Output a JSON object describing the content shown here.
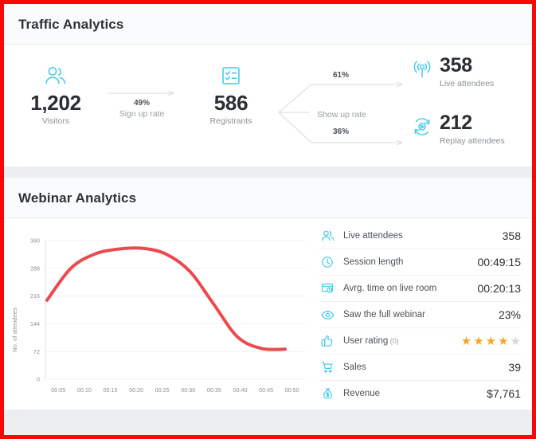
{
  "traffic": {
    "title": "Traffic Analytics",
    "visitors": {
      "icon": "users-icon",
      "value": "1,202",
      "label": "Visitors"
    },
    "registrants": {
      "icon": "checklist-icon",
      "value": "586",
      "label": "Registrants"
    },
    "signup_rate": {
      "pct": "49%",
      "caption": "Sign up rate"
    },
    "show_up_rate": {
      "caption": "Show up rate",
      "live_pct": "61%",
      "replay_pct": "36%"
    },
    "live_attendees": {
      "icon": "broadcast-icon",
      "value": "358",
      "label": "Live attendees"
    },
    "replay_attendees": {
      "icon": "replay-icon",
      "value": "212",
      "label": "Replay attendees"
    }
  },
  "webinar": {
    "title": "Webinar Analytics",
    "metrics": [
      {
        "icon": "users-icon",
        "label": "Live attendees",
        "value": "358",
        "type": "text"
      },
      {
        "icon": "clock-icon",
        "label": "Session length",
        "value": "00:49:15",
        "type": "text"
      },
      {
        "icon": "live-room-icon",
        "label": "Avrg. time on live room",
        "value": "00:20:13",
        "type": "text"
      },
      {
        "icon": "eye-icon",
        "label": "Saw the full webinar",
        "value": "23%",
        "type": "text"
      },
      {
        "icon": "thumbs-up-icon",
        "label": "User rating",
        "rating_count": "(0)",
        "value": "",
        "type": "stars",
        "stars_filled": 4,
        "stars_total": 5
      },
      {
        "icon": "cart-icon",
        "label": "Sales",
        "value": "39",
        "type": "text"
      },
      {
        "icon": "money-bag-icon",
        "label": "Revenue",
        "value": "$7,761",
        "type": "text"
      }
    ]
  },
  "colors": {
    "border": "#fb0707",
    "accent_cyan": "#3fc9e8",
    "line_red": "#ea4a4f",
    "star_on": "#f6a623",
    "star_off": "#d4d8dc"
  },
  "chart_data": {
    "type": "line",
    "title": "",
    "xlabel": "",
    "ylabel": "No. of attendees",
    "ylim": [
      0,
      360
    ],
    "yticks": [
      0,
      72,
      144,
      216,
      288,
      360
    ],
    "ytick_labels": [
      "0",
      "72",
      "144",
      "216",
      "288",
      "360"
    ],
    "xtick_labels": [
      "00:05",
      "00:10",
      "00:15",
      "00:20",
      "00:25",
      "00:30",
      "00:35",
      "00:40",
      "00:45",
      "00:50"
    ],
    "grid": true,
    "series": [
      {
        "name": "Attendees",
        "color": "#ea4a4f",
        "x": [
          "00:00",
          "00:05",
          "00:10",
          "00:15",
          "00:20",
          "00:25",
          "00:30",
          "00:35",
          "00:40",
          "00:45",
          "00:50"
        ],
        "values": [
          205,
          288,
          325,
          338,
          340,
          325,
          280,
          195,
          110,
          80,
          78
        ]
      }
    ]
  }
}
